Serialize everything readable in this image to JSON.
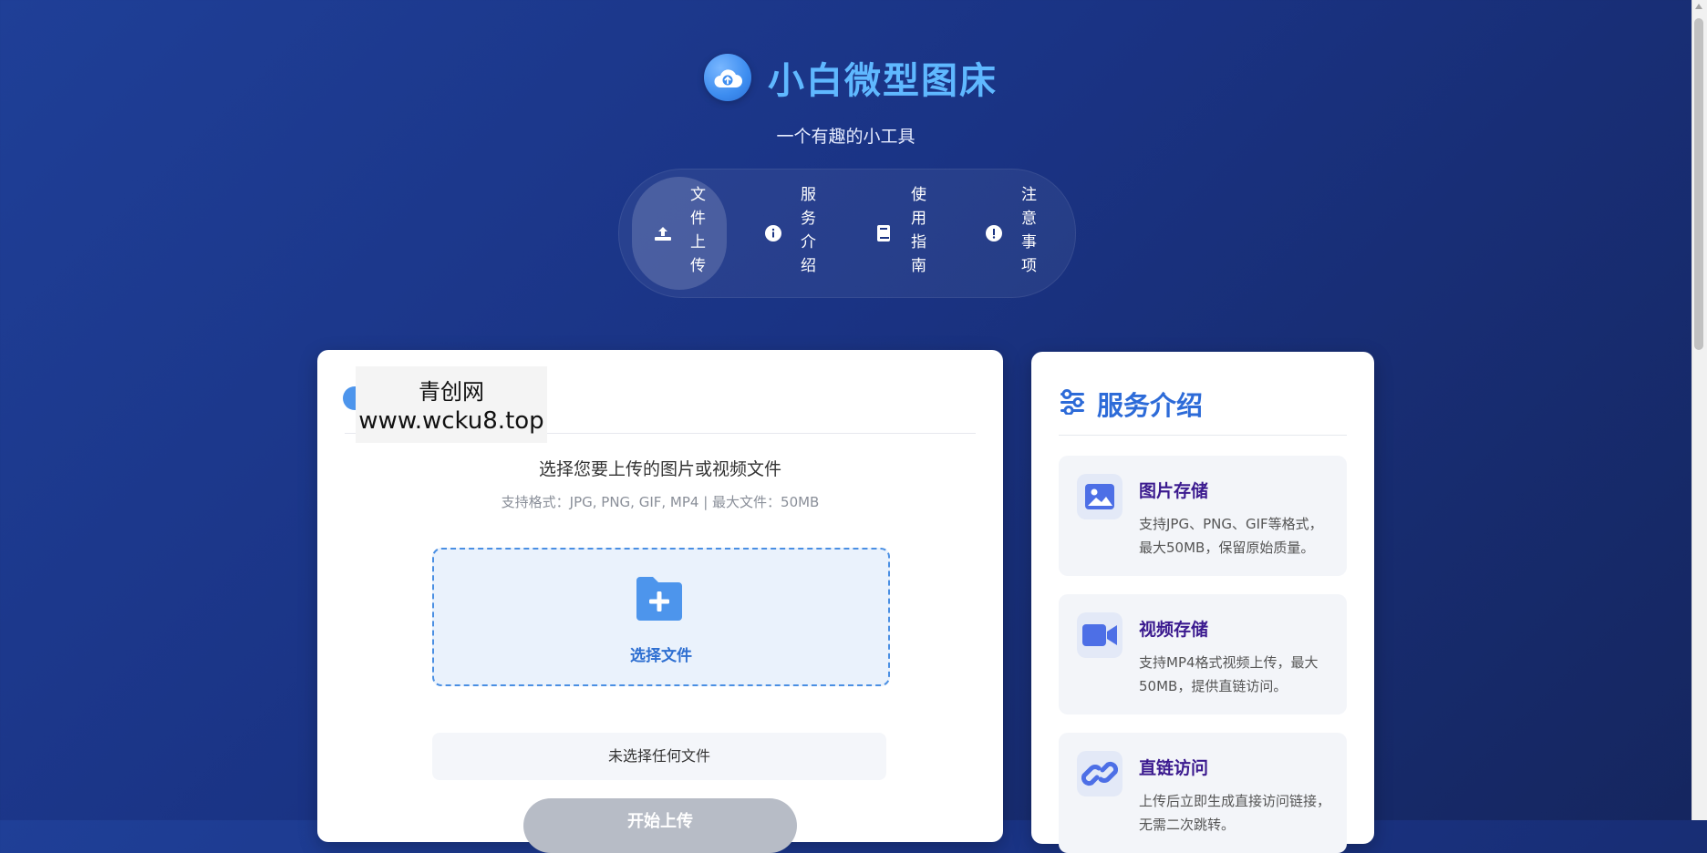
{
  "header": {
    "title": "小白微型图床",
    "subtitle": "一个有趣的小工具",
    "logo_icon": "cloud-upload-icon"
  },
  "nav": {
    "tabs": [
      {
        "label": "文件上传",
        "icon": "upload-icon",
        "active": true
      },
      {
        "label": "服务介绍",
        "icon": "info-icon",
        "active": false
      },
      {
        "label": "使用指南",
        "icon": "book-icon",
        "active": false
      },
      {
        "label": "注意事项",
        "icon": "alert-icon",
        "active": false
      }
    ]
  },
  "watermark": {
    "line1": "青创网",
    "line2": "www.wcku8.top"
  },
  "upload": {
    "heading": "选择您要上传的图片或视频文件",
    "formats": "支持格式：JPG, PNG, GIF, MP4 | 最大文件：50MB",
    "choose_label": "选择文件",
    "file_status": "未选择任何文件",
    "button_label": "开始上传"
  },
  "services": {
    "title": "服务介绍",
    "items": [
      {
        "title": "图片存储",
        "desc": "支持JPG、PNG、GIF等格式，最大50MB，保留原始质量。",
        "icon": "image-icon"
      },
      {
        "title": "视频存储",
        "desc": "支持MP4格式视频上传，最大50MB，提供直链访问。",
        "icon": "video-icon"
      },
      {
        "title": "直链访问",
        "desc": "上传后立即生成直接访问链接，无需二次跳转。",
        "icon": "link-icon"
      }
    ]
  },
  "colors": {
    "accent": "#2d6bd8",
    "title_blue": "#5fb8ff",
    "feature_title": "#3b1a8f"
  }
}
